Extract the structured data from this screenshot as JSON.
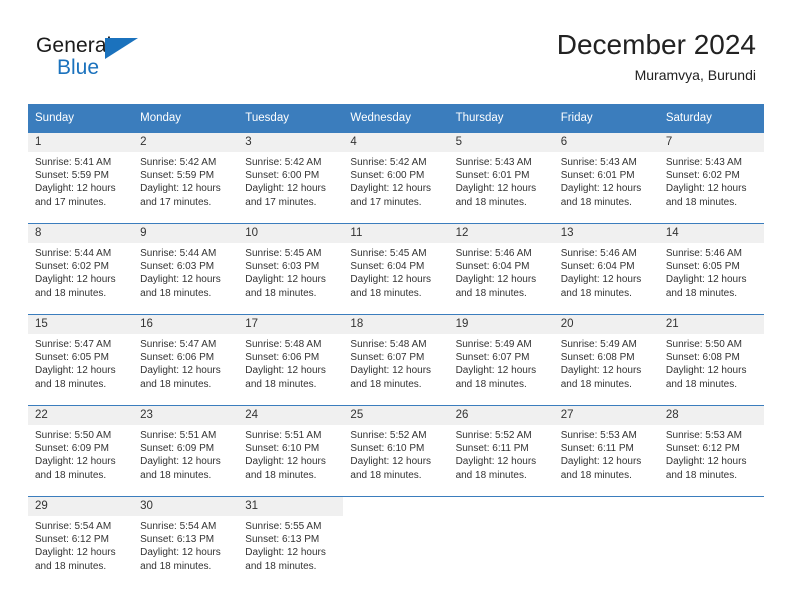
{
  "brand": {
    "name_part1": "General",
    "name_part2": "Blue",
    "accent_color": "#1b72bd"
  },
  "header": {
    "month_title": "December 2024",
    "location": "Muramvya, Burundi"
  },
  "theme": {
    "header_row_bg": "#3b7dbd",
    "daynum_bg": "#f0f0f0",
    "text_color": "#333333"
  },
  "weekday_headers": [
    "Sunday",
    "Monday",
    "Tuesday",
    "Wednesday",
    "Thursday",
    "Friday",
    "Saturday"
  ],
  "weeks": [
    [
      {
        "day": "1",
        "sunrise": "Sunrise: 5:41 AM",
        "sunset": "Sunset: 5:59 PM",
        "daylight": "Daylight: 12 hours and 17 minutes."
      },
      {
        "day": "2",
        "sunrise": "Sunrise: 5:42 AM",
        "sunset": "Sunset: 5:59 PM",
        "daylight": "Daylight: 12 hours and 17 minutes."
      },
      {
        "day": "3",
        "sunrise": "Sunrise: 5:42 AM",
        "sunset": "Sunset: 6:00 PM",
        "daylight": "Daylight: 12 hours and 17 minutes."
      },
      {
        "day": "4",
        "sunrise": "Sunrise: 5:42 AM",
        "sunset": "Sunset: 6:00 PM",
        "daylight": "Daylight: 12 hours and 17 minutes."
      },
      {
        "day": "5",
        "sunrise": "Sunrise: 5:43 AM",
        "sunset": "Sunset: 6:01 PM",
        "daylight": "Daylight: 12 hours and 18 minutes."
      },
      {
        "day": "6",
        "sunrise": "Sunrise: 5:43 AM",
        "sunset": "Sunset: 6:01 PM",
        "daylight": "Daylight: 12 hours and 18 minutes."
      },
      {
        "day": "7",
        "sunrise": "Sunrise: 5:43 AM",
        "sunset": "Sunset: 6:02 PM",
        "daylight": "Daylight: 12 hours and 18 minutes."
      }
    ],
    [
      {
        "day": "8",
        "sunrise": "Sunrise: 5:44 AM",
        "sunset": "Sunset: 6:02 PM",
        "daylight": "Daylight: 12 hours and 18 minutes."
      },
      {
        "day": "9",
        "sunrise": "Sunrise: 5:44 AM",
        "sunset": "Sunset: 6:03 PM",
        "daylight": "Daylight: 12 hours and 18 minutes."
      },
      {
        "day": "10",
        "sunrise": "Sunrise: 5:45 AM",
        "sunset": "Sunset: 6:03 PM",
        "daylight": "Daylight: 12 hours and 18 minutes."
      },
      {
        "day": "11",
        "sunrise": "Sunrise: 5:45 AM",
        "sunset": "Sunset: 6:04 PM",
        "daylight": "Daylight: 12 hours and 18 minutes."
      },
      {
        "day": "12",
        "sunrise": "Sunrise: 5:46 AM",
        "sunset": "Sunset: 6:04 PM",
        "daylight": "Daylight: 12 hours and 18 minutes."
      },
      {
        "day": "13",
        "sunrise": "Sunrise: 5:46 AM",
        "sunset": "Sunset: 6:04 PM",
        "daylight": "Daylight: 12 hours and 18 minutes."
      },
      {
        "day": "14",
        "sunrise": "Sunrise: 5:46 AM",
        "sunset": "Sunset: 6:05 PM",
        "daylight": "Daylight: 12 hours and 18 minutes."
      }
    ],
    [
      {
        "day": "15",
        "sunrise": "Sunrise: 5:47 AM",
        "sunset": "Sunset: 6:05 PM",
        "daylight": "Daylight: 12 hours and 18 minutes."
      },
      {
        "day": "16",
        "sunrise": "Sunrise: 5:47 AM",
        "sunset": "Sunset: 6:06 PM",
        "daylight": "Daylight: 12 hours and 18 minutes."
      },
      {
        "day": "17",
        "sunrise": "Sunrise: 5:48 AM",
        "sunset": "Sunset: 6:06 PM",
        "daylight": "Daylight: 12 hours and 18 minutes."
      },
      {
        "day": "18",
        "sunrise": "Sunrise: 5:48 AM",
        "sunset": "Sunset: 6:07 PM",
        "daylight": "Daylight: 12 hours and 18 minutes."
      },
      {
        "day": "19",
        "sunrise": "Sunrise: 5:49 AM",
        "sunset": "Sunset: 6:07 PM",
        "daylight": "Daylight: 12 hours and 18 minutes."
      },
      {
        "day": "20",
        "sunrise": "Sunrise: 5:49 AM",
        "sunset": "Sunset: 6:08 PM",
        "daylight": "Daylight: 12 hours and 18 minutes."
      },
      {
        "day": "21",
        "sunrise": "Sunrise: 5:50 AM",
        "sunset": "Sunset: 6:08 PM",
        "daylight": "Daylight: 12 hours and 18 minutes."
      }
    ],
    [
      {
        "day": "22",
        "sunrise": "Sunrise: 5:50 AM",
        "sunset": "Sunset: 6:09 PM",
        "daylight": "Daylight: 12 hours and 18 minutes."
      },
      {
        "day": "23",
        "sunrise": "Sunrise: 5:51 AM",
        "sunset": "Sunset: 6:09 PM",
        "daylight": "Daylight: 12 hours and 18 minutes."
      },
      {
        "day": "24",
        "sunrise": "Sunrise: 5:51 AM",
        "sunset": "Sunset: 6:10 PM",
        "daylight": "Daylight: 12 hours and 18 minutes."
      },
      {
        "day": "25",
        "sunrise": "Sunrise: 5:52 AM",
        "sunset": "Sunset: 6:10 PM",
        "daylight": "Daylight: 12 hours and 18 minutes."
      },
      {
        "day": "26",
        "sunrise": "Sunrise: 5:52 AM",
        "sunset": "Sunset: 6:11 PM",
        "daylight": "Daylight: 12 hours and 18 minutes."
      },
      {
        "day": "27",
        "sunrise": "Sunrise: 5:53 AM",
        "sunset": "Sunset: 6:11 PM",
        "daylight": "Daylight: 12 hours and 18 minutes."
      },
      {
        "day": "28",
        "sunrise": "Sunrise: 5:53 AM",
        "sunset": "Sunset: 6:12 PM",
        "daylight": "Daylight: 12 hours and 18 minutes."
      }
    ],
    [
      {
        "day": "29",
        "sunrise": "Sunrise: 5:54 AM",
        "sunset": "Sunset: 6:12 PM",
        "daylight": "Daylight: 12 hours and 18 minutes."
      },
      {
        "day": "30",
        "sunrise": "Sunrise: 5:54 AM",
        "sunset": "Sunset: 6:13 PM",
        "daylight": "Daylight: 12 hours and 18 minutes."
      },
      {
        "day": "31",
        "sunrise": "Sunrise: 5:55 AM",
        "sunset": "Sunset: 6:13 PM",
        "daylight": "Daylight: 12 hours and 18 minutes."
      },
      {
        "day": "",
        "sunrise": "",
        "sunset": "",
        "daylight": ""
      },
      {
        "day": "",
        "sunrise": "",
        "sunset": "",
        "daylight": ""
      },
      {
        "day": "",
        "sunrise": "",
        "sunset": "",
        "daylight": ""
      },
      {
        "day": "",
        "sunrise": "",
        "sunset": "",
        "daylight": ""
      }
    ]
  ]
}
